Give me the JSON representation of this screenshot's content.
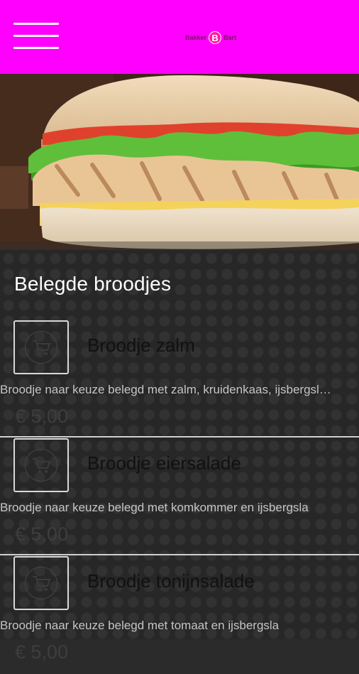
{
  "header": {
    "brand_left": "Bakker",
    "brand_letter": "B",
    "brand_right": "Bart",
    "accent_color": "#ff00ff"
  },
  "hero": {
    "image": "chicken-sandwich-photo"
  },
  "section": {
    "title": "Belegde broodjes"
  },
  "products": [
    {
      "name": "Broodje zalm",
      "description": "Broodje naar keuze belegd met zalm, kruidenkaas, ijsbergsla en tomaat",
      "price": "€ 5,00"
    },
    {
      "name": "Broodje eiersalade",
      "description": "Broodje naar keuze belegd met komkommer en ijsbergsla",
      "price": "€ 5,00"
    },
    {
      "name": "Broodje tonijnsalade",
      "description": "Broodje naar keuze belegd met tomaat en ijsbergsla",
      "price": "€ 5,00"
    }
  ]
}
